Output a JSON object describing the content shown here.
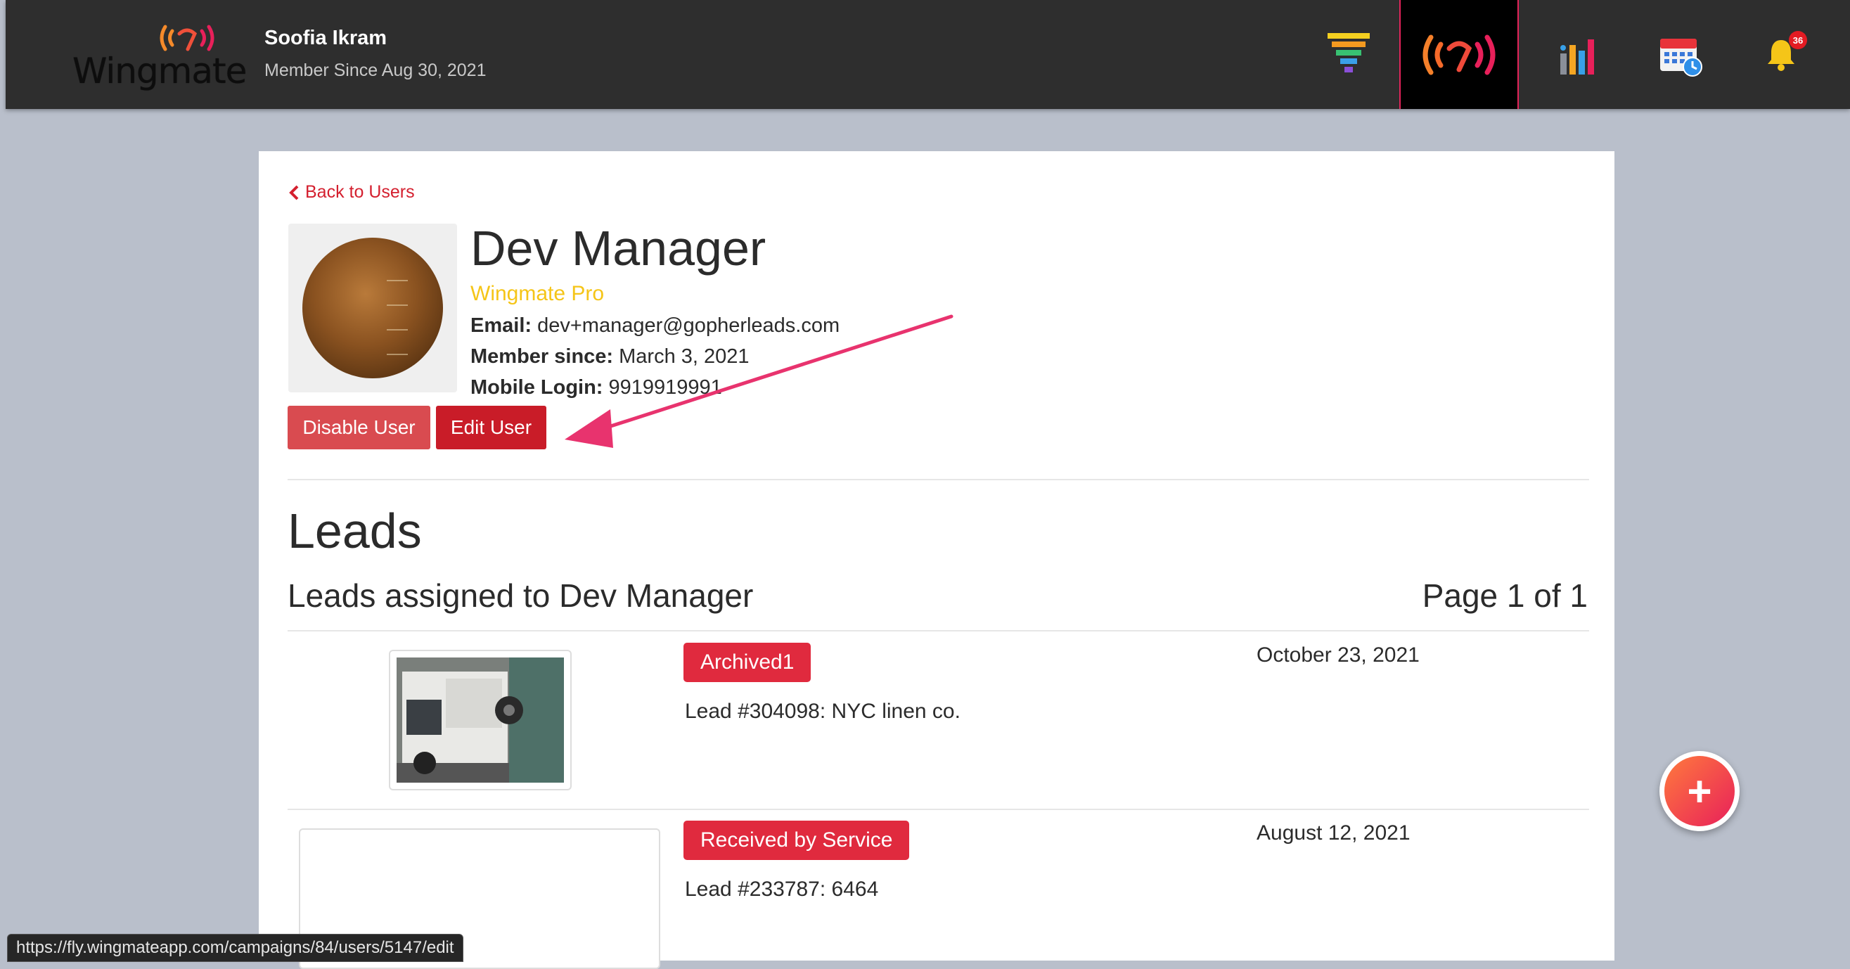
{
  "header": {
    "logo_text": "Wingmate",
    "user_name": "Soofia Ikram",
    "member_since": "Member Since Aug 30, 2021",
    "notification_count": "36"
  },
  "nav_icons": [
    "funnel-icon",
    "wingmate-signal-icon",
    "bar-chart-icon",
    "calendar-icon",
    "bell-icon"
  ],
  "profile": {
    "back_label": "Back to Users",
    "name": "Dev Manager",
    "tier": "Wingmate Pro",
    "email_label": "Email:",
    "email": "dev+manager@gopherleads.com",
    "member_since_label": "Member since:",
    "member_since": "March 3, 2021",
    "mobile_label": "Mobile Login:",
    "mobile": "9919919991",
    "disable_button": "Disable User",
    "edit_button": "Edit User"
  },
  "leads": {
    "title": "Leads",
    "subtitle": "Leads assigned to Dev Manager",
    "page_info": "Page 1 of 1",
    "items": [
      {
        "status": "Archived1",
        "title": "Lead #304098: NYC linen co.",
        "date": "October 23, 2021"
      },
      {
        "status": "Received by Service",
        "title": "Lead #233787: 6464",
        "date": "August 12, 2021"
      }
    ]
  },
  "status_url": "https://fly.wingmateapp.com/campaigns/84/users/5147/edit",
  "colors": {
    "accent_red": "#c91c28",
    "tier_yellow": "#f5c518",
    "status_red": "#e02a3e",
    "annotation_pink": "#e8336e"
  }
}
